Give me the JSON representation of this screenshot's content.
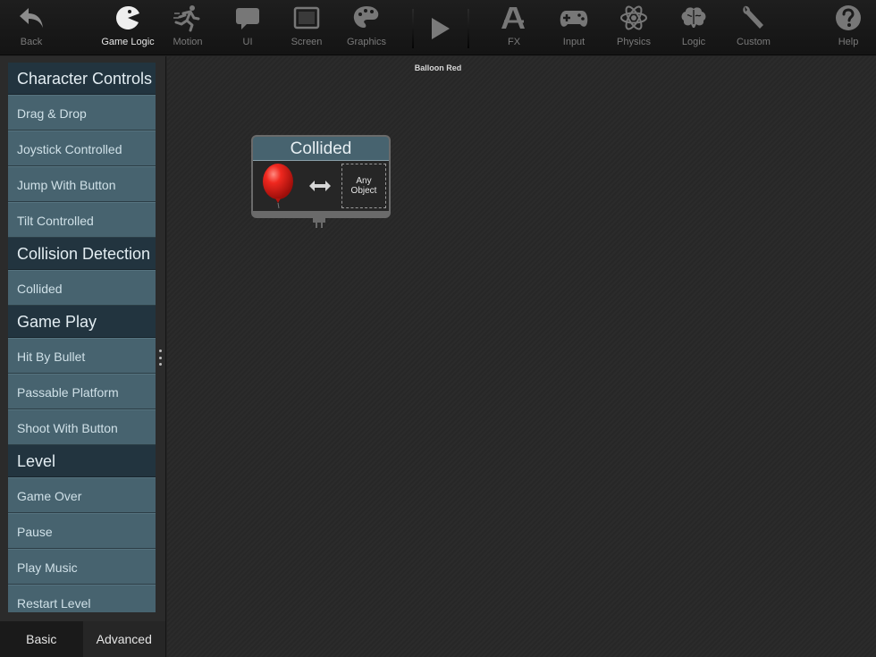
{
  "toolbar": {
    "back": {
      "label": "Back",
      "icon": "back-arrow-icon"
    },
    "items": [
      {
        "label": "Game Logic",
        "icon": "pacman-icon",
        "active": true
      },
      {
        "label": "Motion",
        "icon": "running-man-icon"
      },
      {
        "label": "UI",
        "icon": "speech-bubble-icon"
      },
      {
        "label": "Screen",
        "icon": "screen-icon"
      },
      {
        "label": "Graphics",
        "icon": "palette-icon"
      }
    ],
    "play_icon": "play-icon",
    "right_items": [
      {
        "label": "FX",
        "icon": "app-store-icon"
      },
      {
        "label": "Input",
        "icon": "gamepad-icon"
      },
      {
        "label": "Physics",
        "icon": "atom-icon"
      },
      {
        "label": "Logic",
        "icon": "brain-icon"
      },
      {
        "label": "Custom",
        "icon": "wrench-icon"
      }
    ],
    "help": {
      "label": "Help",
      "icon": "help-icon"
    }
  },
  "sidebar": {
    "categories": [
      {
        "title": "Character Controls",
        "items": [
          "Drag & Drop",
          "Joystick Controlled",
          "Jump With Button",
          "Tilt Controlled"
        ]
      },
      {
        "title": "Collision Detection",
        "items": [
          "Collided"
        ]
      },
      {
        "title": "Game Play",
        "items": [
          "Hit By Bullet",
          "Passable Platform",
          "Shoot With Button"
        ]
      },
      {
        "title": "Level",
        "items": [
          "Game Over",
          "Pause",
          "Play Music",
          "Restart Level"
        ]
      }
    ],
    "tabs": {
      "basic": "Basic",
      "advanced": "Advanced"
    }
  },
  "canvas": {
    "actor_name": "Balloon Red",
    "behavior": {
      "title": "Collided",
      "target": "Any\nObject"
    }
  },
  "colors": {
    "toolbar_bg": "#161616",
    "category_bg": "#22343f",
    "item_bg": "#47636f",
    "canvas_bg": "#272727",
    "balloon": "#e0201c"
  }
}
